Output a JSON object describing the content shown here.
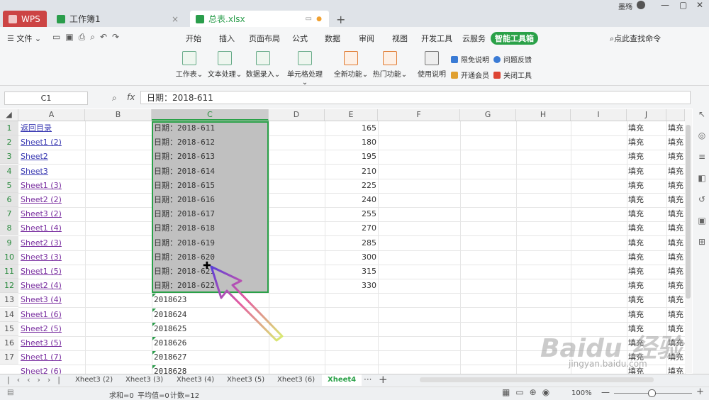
{
  "titlebar": {
    "tabs": [
      {
        "label": "WPS"
      },
      {
        "label": "工作簿1"
      },
      {
        "label": "总表.xlsx"
      }
    ],
    "user": "墨殇"
  },
  "menubar": {
    "file": "文件",
    "items": [
      "开始",
      "插入",
      "页面布局",
      "公式",
      "数据",
      "审阅",
      "视图",
      "开发工具",
      "云服务",
      "智能工具箱"
    ],
    "search": "点此查找命令"
  },
  "ribbon": {
    "buttons": [
      "工作表",
      "文本处理",
      "数据录入",
      "单元格处理",
      "全新功能",
      "热门功能",
      "使用说明"
    ],
    "small": [
      "限免说明",
      "问题反馈",
      "开通会员",
      "关闭工具"
    ]
  },
  "formula_bar": {
    "cell_ref": "C1",
    "fx": "fx",
    "value": "日期：2018-611"
  },
  "columns": [
    "A",
    "B",
    "C",
    "D",
    "E",
    "F",
    "G",
    "H",
    "I",
    "J"
  ],
  "rows": [
    "1",
    "2",
    "3",
    "4",
    "5",
    "6",
    "7",
    "8",
    "9",
    "10",
    "11",
    "12",
    "13",
    "14",
    "15",
    "16",
    "17"
  ],
  "col_a": [
    "返回目录",
    "Sheet1 (2)",
    "Sheet2",
    "Sheet3",
    "Sheet1 (3)",
    "Sheet2 (2)",
    "Sheet3 (2)",
    "Sheet1 (4)",
    "Sheet2 (3)",
    "Sheet3 (3)",
    "Sheet1 (5)",
    "Sheet2 (4)",
    "Sheet3 (4)",
    "Sheet1 (6)",
    "Sheet2 (5)",
    "Sheet3 (5)",
    "Sheet1 (7)",
    "Sheet2 (6)"
  ],
  "col_c": [
    "日期：2018-611",
    "日期：2018-612",
    "日期：2018-613",
    "日期：2018-614",
    "日期：2018-615",
    "日期：2018-616",
    "日期：2018-617",
    "日期：2018-618",
    "日期：2018-619",
    "日期：2018-620",
    "日期：2018-621",
    "日期：2018-622",
    "2018623",
    "2018624",
    "2018625",
    "2018626",
    "2018627",
    "2018628"
  ],
  "col_e": [
    "165",
    "180",
    "195",
    "210",
    "225",
    "240",
    "255",
    "270",
    "285",
    "300",
    "315",
    "330"
  ],
  "col_j": "填充",
  "col_k": "填充",
  "sheet_tabs": [
    "Xheet3 (2)",
    "Xheet3 (3)",
    "Xheet3 (4)",
    "Xheet3 (5)",
    "Xheet3 (6)",
    "Xheet4"
  ],
  "status": {
    "sum": "求和=0",
    "avg": "平均值=0",
    "count": "计数=12",
    "zoom": "100%"
  },
  "watermark": "Baidu 经验",
  "watermark_url": "jingyan.baidu.com"
}
